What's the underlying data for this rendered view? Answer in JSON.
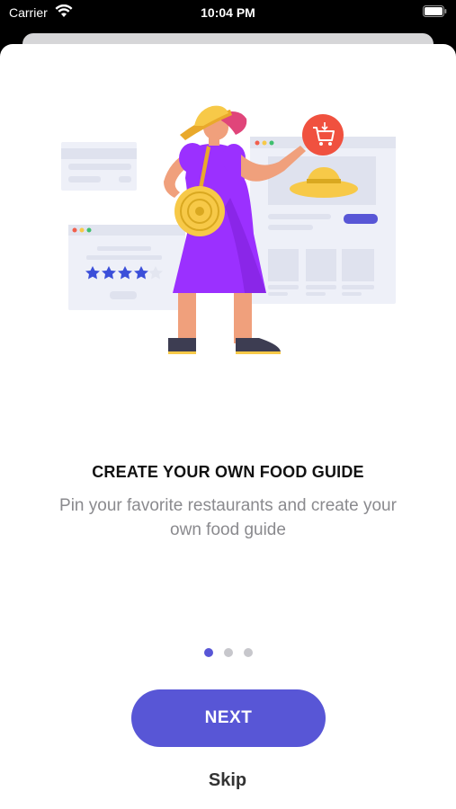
{
  "status_bar": {
    "carrier": "Carrier",
    "time": "10:04 PM",
    "wifi_icon": "wifi-icon",
    "battery_icon": "battery-full-icon"
  },
  "onboarding": {
    "illustration": "woman-shopping-hat-illustration",
    "title": "CREATE YOUR OWN FOOD GUIDE",
    "subtitle": "Pin your favorite restaurants and create your own food guide",
    "page_indicator": {
      "total": 3,
      "current": 1
    },
    "next_label": "NEXT",
    "skip_label": "Skip"
  },
  "colors": {
    "accent": "#5856d6",
    "dress": "#9b30ff",
    "cart_badge": "#f0513f",
    "hat": "#f7c948",
    "stars": "#3b4fd9"
  }
}
